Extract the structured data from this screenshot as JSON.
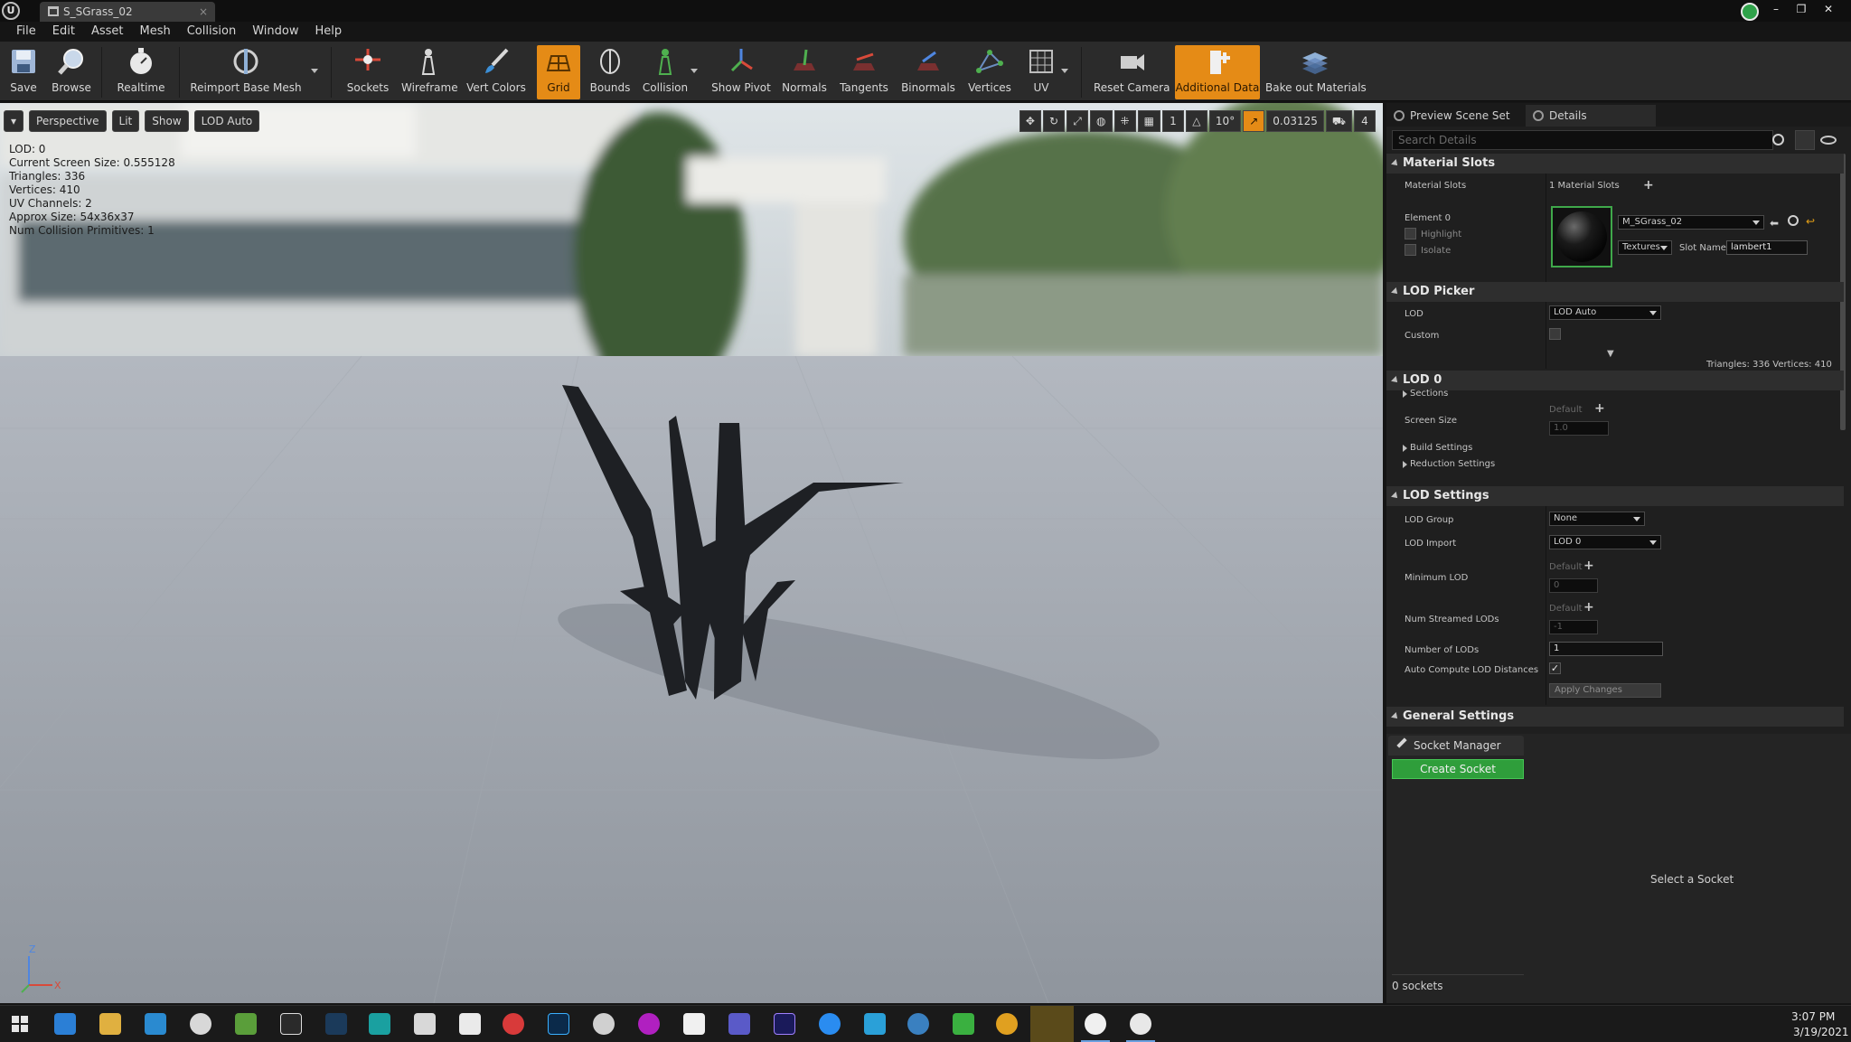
{
  "window": {
    "tab_title": "S_SGrass_02",
    "tab_close": "×",
    "min_symbol": "–",
    "restore_symbol": "❐",
    "close_symbol": "✕",
    "logo_letter": "U"
  },
  "menu": [
    "File",
    "Edit",
    "Asset",
    "Mesh",
    "Collision",
    "Window",
    "Help"
  ],
  "toolbar": {
    "save": "Save",
    "browse": "Browse",
    "realtime": "Realtime",
    "reimport": "Reimport Base Mesh",
    "sockets": "Sockets",
    "wireframe": "Wireframe",
    "vert_colors": "Vert Colors",
    "grid": "Grid",
    "bounds": "Bounds",
    "collision": "Collision",
    "show_pivot": "Show Pivot",
    "normals": "Normals",
    "tangents": "Tangents",
    "binormals": "Binormals",
    "vertices": "Vertices",
    "uv": "UV",
    "reset_camera": "Reset Camera",
    "additional_data": "Additional Data",
    "bake_out": "Bake out Materials"
  },
  "viewport": {
    "menu_arrow": "▾",
    "perspective": "Perspective",
    "lit": "Lit",
    "show": "Show",
    "lod_auto": "LOD Auto",
    "stats": [
      "LOD:  0",
      "Current Screen Size:  0.555128",
      "Triangles:  336",
      "Vertices:  410",
      "UV Channels:  2",
      "Approx Size: 54x36x37",
      "Num Collision Primitives:  1"
    ],
    "grid_step": "1",
    "rot_angle": "10°",
    "scale_value": "0.03125",
    "cam_speed": "4",
    "axis_z": "Z",
    "axis_x": "X"
  },
  "details": {
    "tab_preview": "Preview Scene Set",
    "tab_details": "Details",
    "search_placeholder": "Search Details",
    "material_slots_header": "Material Slots",
    "material_slots_label": "Material Slots",
    "material_slots_value": "1 Material Slots",
    "element0": "Element 0",
    "highlight": "Highlight",
    "isolate": "Isolate",
    "material_name": "M_SGrass_02",
    "textures": "Textures",
    "slot_name_label": "Slot Name",
    "slot_name_value": "lambert1",
    "lod_picker_header": "LOD Picker",
    "lod_label": "LOD",
    "lod_value": "LOD Auto",
    "custom_label": "Custom",
    "tri_vert_info": "Triangles: 336   Vertices: 410",
    "lod0_header": "LOD 0",
    "sections": "Sections",
    "screen_size": "Screen Size",
    "default": "Default",
    "screen_size_value": "1.0",
    "build_settings": "Build Settings",
    "reduction_settings": "Reduction Settings",
    "lod_settings_header": "LOD Settings",
    "lod_group": "LOD Group",
    "lod_group_value": "None",
    "lod_import": "LOD Import",
    "lod_import_value": "LOD 0",
    "minimum_lod": "Minimum LOD",
    "minimum_lod_value": "0",
    "num_streamed": "Num Streamed LODs",
    "num_streamed_value": "-1",
    "number_of_lods": "Number of LODs",
    "number_of_lods_value": "1",
    "auto_compute": "Auto Compute LOD Distances",
    "apply_changes": "Apply Changes",
    "general_settings_header": "General Settings",
    "plus": "+",
    "check": "✓"
  },
  "sockets": {
    "tab": "Socket Manager",
    "create": "Create Socket",
    "select": "Select a Socket",
    "count": "0 sockets"
  },
  "taskbar": {
    "time": "3:07 PM",
    "date": "3/19/2021"
  },
  "colors": {
    "accent_orange": "#e58b16",
    "create_green": "#2f9e3b"
  }
}
